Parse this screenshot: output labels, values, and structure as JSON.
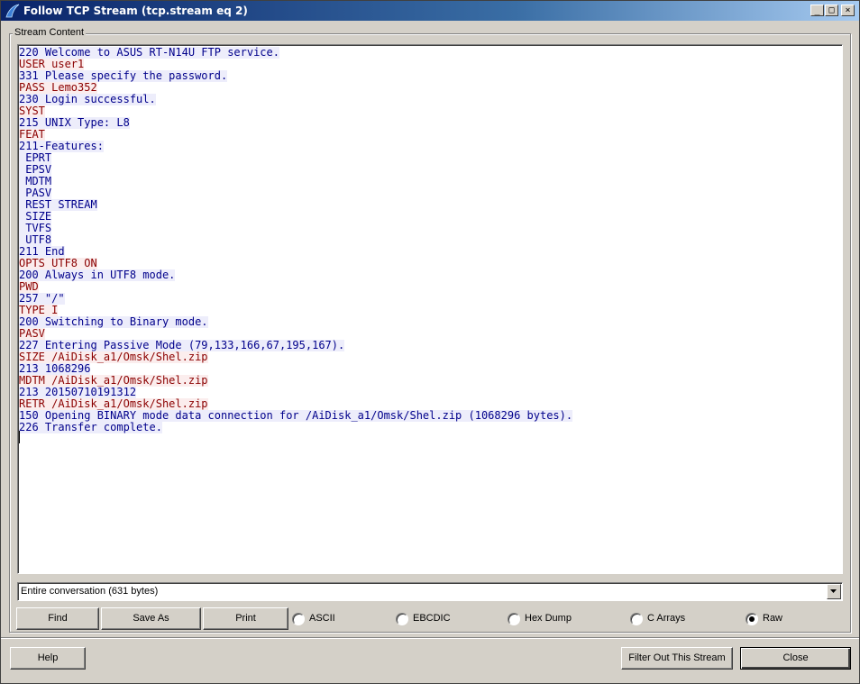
{
  "window": {
    "title": "Follow TCP Stream (tcp.stream eq 2)",
    "minimize_glyph": "_",
    "maximize_glyph": "□",
    "close_glyph": "×"
  },
  "stream_group_label": "Stream Content",
  "colors": {
    "client": "#8b0000",
    "client_bg": "#fbeded",
    "server": "#00008b",
    "server_bg": "#ededfb"
  },
  "stream_lines": [
    {
      "dir": "s",
      "text": "220 Welcome to ASUS RT-N14U FTP service."
    },
    {
      "dir": "c",
      "text": "USER user1"
    },
    {
      "dir": "s",
      "text": "331 Please specify the password."
    },
    {
      "dir": "c",
      "text": "PASS Lemo352"
    },
    {
      "dir": "s",
      "text": "230 Login successful."
    },
    {
      "dir": "c",
      "text": "SYST"
    },
    {
      "dir": "s",
      "text": "215 UNIX Type: L8"
    },
    {
      "dir": "c",
      "text": "FEAT"
    },
    {
      "dir": "s",
      "text": "211-Features:"
    },
    {
      "dir": "s",
      "text": " EPRT"
    },
    {
      "dir": "s",
      "text": " EPSV"
    },
    {
      "dir": "s",
      "text": " MDTM"
    },
    {
      "dir": "s",
      "text": " PASV"
    },
    {
      "dir": "s",
      "text": " REST STREAM"
    },
    {
      "dir": "s",
      "text": " SIZE"
    },
    {
      "dir": "s",
      "text": " TVFS"
    },
    {
      "dir": "s",
      "text": " UTF8"
    },
    {
      "dir": "s",
      "text": "211 End"
    },
    {
      "dir": "c",
      "text": "OPTS UTF8 ON"
    },
    {
      "dir": "s",
      "text": "200 Always in UTF8 mode."
    },
    {
      "dir": "c",
      "text": "PWD"
    },
    {
      "dir": "s",
      "text": "257 \"/\""
    },
    {
      "dir": "c",
      "text": "TYPE I"
    },
    {
      "dir": "s",
      "text": "200 Switching to Binary mode."
    },
    {
      "dir": "c",
      "text": "PASV"
    },
    {
      "dir": "s",
      "text": "227 Entering Passive Mode (79,133,166,67,195,167)."
    },
    {
      "dir": "c",
      "text": "SIZE /AiDisk_a1/Omsk/Shel.zip"
    },
    {
      "dir": "s",
      "text": "213 1068296"
    },
    {
      "dir": "c",
      "text": "MDTM /AiDisk_a1/Omsk/Shel.zip"
    },
    {
      "dir": "s",
      "text": "213 20150710191312"
    },
    {
      "dir": "c",
      "text": "RETR /AiDisk_a1/Omsk/Shel.zip"
    },
    {
      "dir": "s",
      "text": "150 Opening BINARY mode data connection for /AiDisk_a1/Omsk/Shel.zip (1068296 bytes)."
    },
    {
      "dir": "s",
      "text": "226 Transfer complete."
    }
  ],
  "conversation_select": {
    "selected": "Entire conversation (631 bytes)"
  },
  "buttons": {
    "find": "Find",
    "save_as": "Save As",
    "print": "Print",
    "help": "Help",
    "filter_out": "Filter Out This Stream",
    "close": "Close"
  },
  "format_options": [
    {
      "label": "ASCII",
      "selected": false
    },
    {
      "label": "EBCDIC",
      "selected": false
    },
    {
      "label": "Hex Dump",
      "selected": false
    },
    {
      "label": "C Arrays",
      "selected": false
    },
    {
      "label": "Raw",
      "selected": true
    }
  ]
}
